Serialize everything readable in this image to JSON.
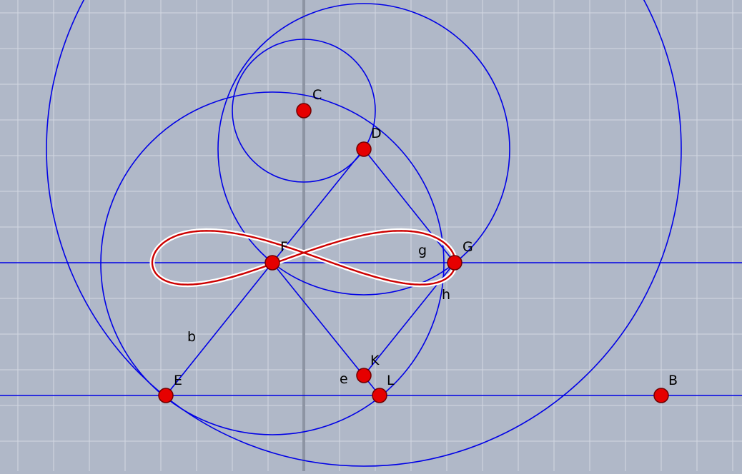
{
  "colors": {
    "background": "#b0b8c8",
    "grid": "#d3d8e2",
    "axis": "#8d94a3",
    "construction": "#0000e6",
    "curve": "#cc0000",
    "curve_halo": "#ffffff",
    "point_fill": "#e60000",
    "point_stroke": "#700000"
  },
  "points": {
    "C": {
      "label": "C"
    },
    "D": {
      "label": "D"
    },
    "F": {
      "label": "F"
    },
    "G": {
      "label": "G"
    },
    "K": {
      "label": "K"
    },
    "E": {
      "label": "E"
    },
    "L": {
      "label": "L"
    },
    "B": {
      "label": "B"
    }
  },
  "labels": {
    "b": "b",
    "e": "e",
    "g": "g",
    "h": "h"
  }
}
